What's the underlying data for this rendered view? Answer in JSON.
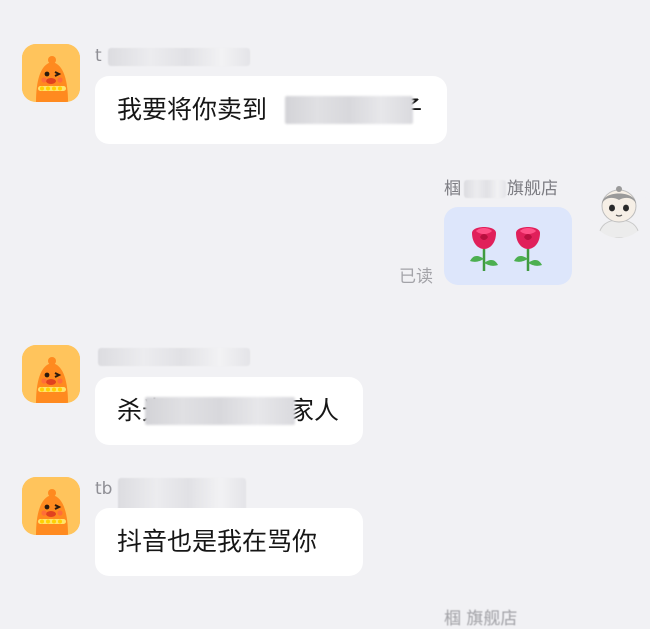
{
  "colors": {
    "background": "#f1f1f4",
    "bubble_incoming": "#ffffff",
    "bubble_outgoing": "#dde6fb",
    "read_status": "#a3a3a8"
  },
  "messages": [
    {
      "side": "left",
      "avatar_icon": "orange-duck-mascot-avatar-icon",
      "sender": "t",
      "text_before": "我要将你卖到",
      "text_after": "子"
    },
    {
      "side": "right",
      "avatar_icon": "cartoon-boy-avatar-icon",
      "sender_before": "椢",
      "sender_after": "旗舰店",
      "content_icons": [
        "rose-emoji-icon",
        "rose-emoji-icon"
      ],
      "status": "已读"
    },
    {
      "side": "left",
      "avatar_icon": "orange-duck-mascot-avatar-icon",
      "sender": "",
      "text_before": "杀光",
      "text_after": "家人"
    },
    {
      "side": "left",
      "avatar_icon": "orange-duck-mascot-avatar-icon",
      "sender": "tb",
      "text": "抖音也是我在骂你"
    }
  ],
  "bottom_peek": "椢 旗舰店"
}
